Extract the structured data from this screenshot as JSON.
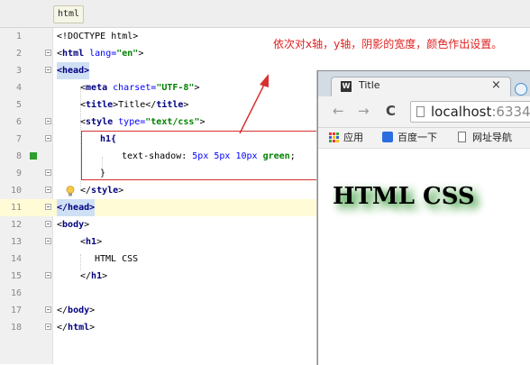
{
  "ide": {
    "file_tab": "html",
    "lines": [
      "1",
      "2",
      "3",
      "4",
      "5",
      "6",
      "7",
      "8",
      "9",
      "10",
      "11",
      "12",
      "13",
      "14",
      "15",
      "16",
      "17",
      "18"
    ],
    "code": {
      "l1": "<!DOCTYPE html>",
      "l2_open": "<",
      "l2_tag": "html",
      "l2_attr": " lang=",
      "l2_val": "\"en\"",
      "l2_close": ">",
      "l3": "<head>",
      "l4_open": "<",
      "l4_tag": "meta",
      "l4_attr": " charset=",
      "l4_val": "\"UTF-8\"",
      "l4_close": ">",
      "l5_open": "<",
      "l5_tag": "title",
      "l5_mid": ">Title</",
      "l5_tag2": "title",
      "l5_close": ">",
      "l6_open": "<",
      "l6_tag": "style",
      "l6_attr": " type=",
      "l6_val": "\"text/css\"",
      "l6_close": ">",
      "l7": "h1{",
      "l8_prop": "text-shadow: ",
      "l8_v1": "5px",
      "l8_v2": "5px",
      "l8_v3": "10px",
      "l8_v4": "green",
      "l8_end": ";",
      "l9": "}",
      "l10_open": "</",
      "l10_tag": "style",
      "l10_close": ">",
      "l11": "</head>",
      "l12_open": "<",
      "l12_tag": "body",
      "l12_close": ">",
      "l13_open": "<",
      "l13_tag": "h1",
      "l13_close": ">",
      "l14": "HTML CSS",
      "l15_open": "</",
      "l15_tag": "h1",
      "l15_close": ">",
      "l17_open": "</",
      "l17_tag": "body",
      "l17_close": ">",
      "l18_open": "</",
      "l18_tag": "html",
      "l18_close": ">"
    }
  },
  "annotation": {
    "text": "依次对x轴，y轴，阴影的宽度，颜色作出设置。"
  },
  "browser": {
    "tab_icon": "W",
    "tab_title": "Title",
    "close": "×",
    "back": "←",
    "forward": "→",
    "reload": "C",
    "url_host": "localhost",
    "url_port": ":6334",
    "bookmarks": {
      "apps": "应用",
      "baidu": "百度一下",
      "nav": "网址导航"
    },
    "h1_text": "HTML CSS"
  },
  "colors": {
    "annotation": "#e02020",
    "shadow": "green",
    "string": "#008000",
    "keyword": "#000080"
  }
}
